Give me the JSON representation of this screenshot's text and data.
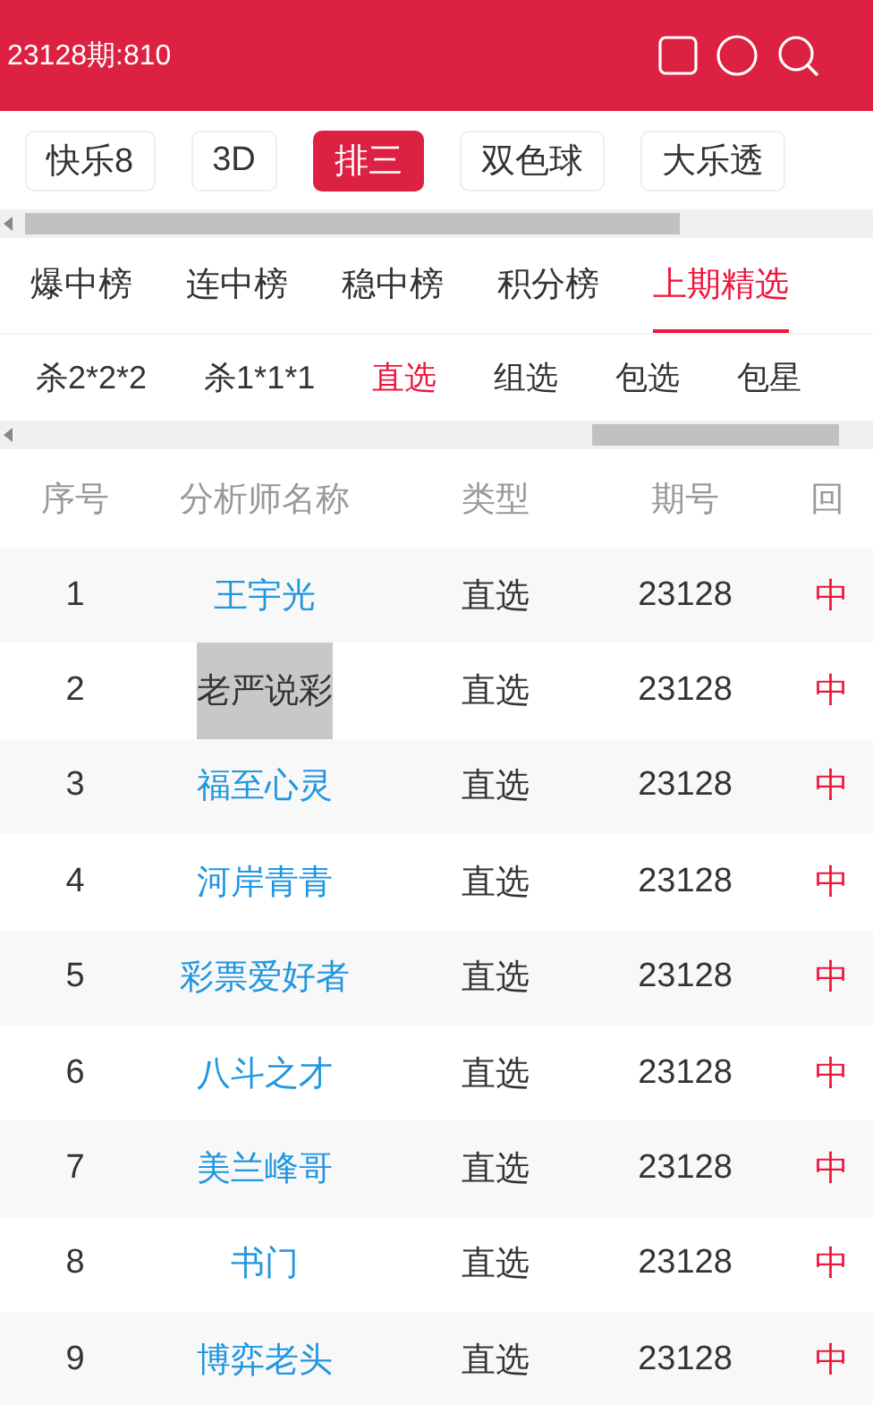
{
  "header": {
    "title": "23128期:810"
  },
  "lottery_tabs": [
    {
      "label": "快乐8",
      "selected": false
    },
    {
      "label": "3D",
      "selected": false
    },
    {
      "label": "排三",
      "selected": true
    },
    {
      "label": "双色球",
      "selected": false
    },
    {
      "label": "大乐透",
      "selected": false
    }
  ],
  "rank_tabs": [
    {
      "label": "爆中榜",
      "selected": false
    },
    {
      "label": "连中榜",
      "selected": false
    },
    {
      "label": "稳中榜",
      "selected": false
    },
    {
      "label": "积分榜",
      "selected": false
    },
    {
      "label": "上期精选",
      "selected": true
    }
  ],
  "sub_tabs": [
    {
      "label": "杀2*2*2",
      "selected": false
    },
    {
      "label": "杀1*1*1",
      "selected": false
    },
    {
      "label": "直选",
      "selected": true
    },
    {
      "label": "组选",
      "selected": false
    },
    {
      "label": "包选",
      "selected": false
    },
    {
      "label": "包星",
      "selected": false
    }
  ],
  "table": {
    "columns": [
      "序号",
      "分析师名称",
      "类型",
      "期号",
      "回"
    ],
    "rows": [
      {
        "index": "1",
        "analyst": "王宇光",
        "type": "直选",
        "issue": "23128",
        "review": "中",
        "highlighted": false
      },
      {
        "index": "2",
        "analyst": "老严说彩",
        "type": "直选",
        "issue": "23128",
        "review": "中",
        "highlighted": true
      },
      {
        "index": "3",
        "analyst": "福至心灵",
        "type": "直选",
        "issue": "23128",
        "review": "中",
        "highlighted": false
      },
      {
        "index": "4",
        "analyst": "河岸青青",
        "type": "直选",
        "issue": "23128",
        "review": "中",
        "highlighted": false
      },
      {
        "index": "5",
        "analyst": "彩票爱好者",
        "type": "直选",
        "issue": "23128",
        "review": "中",
        "highlighted": false
      },
      {
        "index": "6",
        "analyst": "八斗之才",
        "type": "直选",
        "issue": "23128",
        "review": "中",
        "highlighted": false
      },
      {
        "index": "7",
        "analyst": "美兰峰哥",
        "type": "直选",
        "issue": "23128",
        "review": "中",
        "highlighted": false
      },
      {
        "index": "8",
        "analyst": "书门",
        "type": "直选",
        "issue": "23128",
        "review": "中",
        "highlighted": false
      },
      {
        "index": "9",
        "analyst": "博弈老头",
        "type": "直选",
        "issue": "23128",
        "review": "中",
        "highlighted": false
      }
    ]
  }
}
